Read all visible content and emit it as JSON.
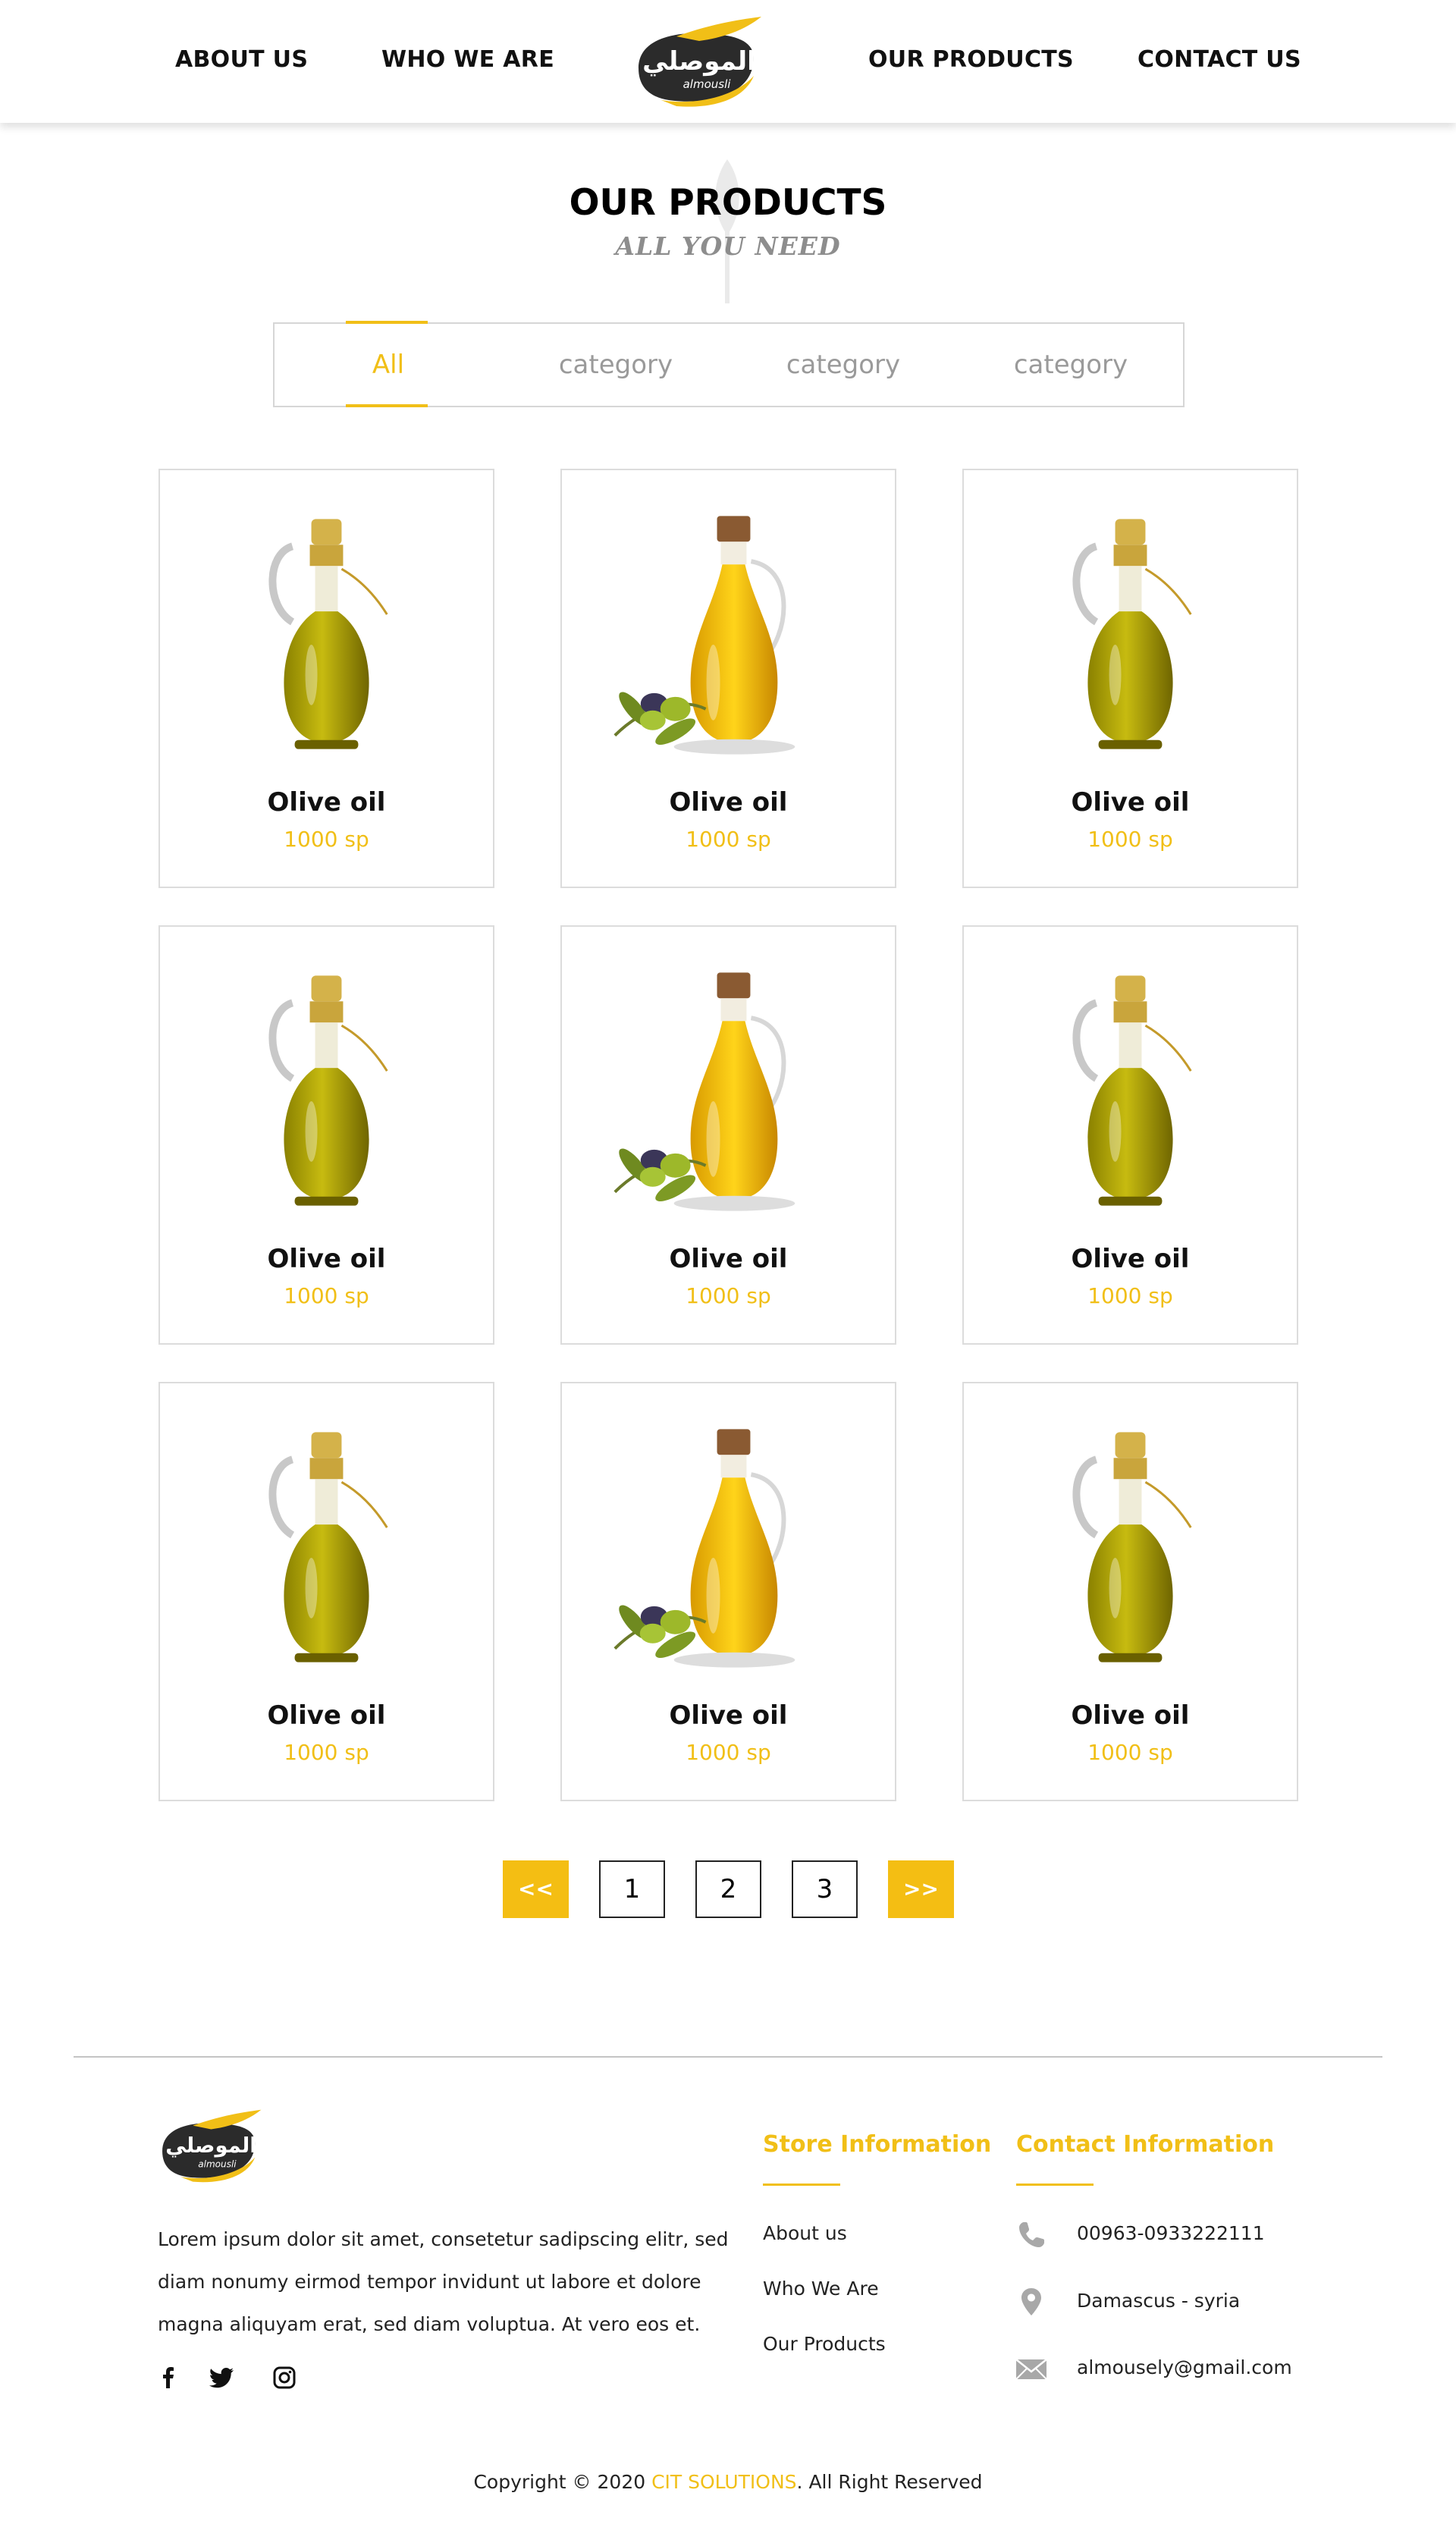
{
  "header": {
    "nav": [
      "ABOUT US",
      "WHO WE ARE",
      "OUR PRODUCTS",
      "CONTACT US"
    ],
    "logo": {
      "arabic": "الموصلي",
      "latin": "almousli"
    }
  },
  "hero": {
    "title": "OUR PRODUCTS",
    "subtitle": "ALL YOU NEED"
  },
  "filters": {
    "tabs": [
      "All",
      "category",
      "category",
      "category"
    ],
    "active_index": 0
  },
  "products": [
    {
      "name": "Olive oil",
      "price": "1000 sp",
      "image": "tall-bottle-icon"
    },
    {
      "name": "Olive oil",
      "price": "1000 sp",
      "image": "jug-olives-icon"
    },
    {
      "name": "Olive oil",
      "price": "1000 sp",
      "image": "tall-bottle-icon"
    },
    {
      "name": "Olive oil",
      "price": "1000 sp",
      "image": "tall-bottle-icon"
    },
    {
      "name": "Olive oil",
      "price": "1000 sp",
      "image": "jug-olives-icon"
    },
    {
      "name": "Olive oil",
      "price": "1000 sp",
      "image": "tall-bottle-icon"
    },
    {
      "name": "Olive oil",
      "price": "1000 sp",
      "image": "tall-bottle-icon"
    },
    {
      "name": "Olive oil",
      "price": "1000 sp",
      "image": "jug-olives-icon"
    },
    {
      "name": "Olive oil",
      "price": "1000 sp",
      "image": "tall-bottle-icon"
    }
  ],
  "pagination": {
    "prev": "<<",
    "pages": [
      "1",
      "2",
      "3"
    ],
    "next": ">>"
  },
  "footer": {
    "description": "Lorem ipsum dolor sit amet, consetetur sadipscing elitr, sed diam nonumy eirmod tempor invidunt ut labore et dolore magna aliquyam erat, sed diam voluptua. At vero eos et.",
    "social": [
      "facebook-icon",
      "twitter-icon",
      "instagram-icon"
    ],
    "store_heading": "Store Information",
    "store_links": [
      "About us",
      "Who We Are",
      "Our Products"
    ],
    "contact_heading": "Contact Information",
    "contacts": [
      {
        "icon": "phone-icon",
        "text": "00963-0933222111"
      },
      {
        "icon": "location-pin-icon",
        "text": "Damascus - syria"
      },
      {
        "icon": "envelope-icon",
        "text": "almousely@gmail.com"
      }
    ],
    "copyright_prefix": "Copyright © 2020 ",
    "copyright_brand": "CIT SOLUTIONS",
    "copyright_suffix": ". All Right Reserved"
  },
  "colors": {
    "accent": "#f1bf17",
    "text": "#111111",
    "muted": "#9a9a9a",
    "border": "#dcdcdc"
  }
}
